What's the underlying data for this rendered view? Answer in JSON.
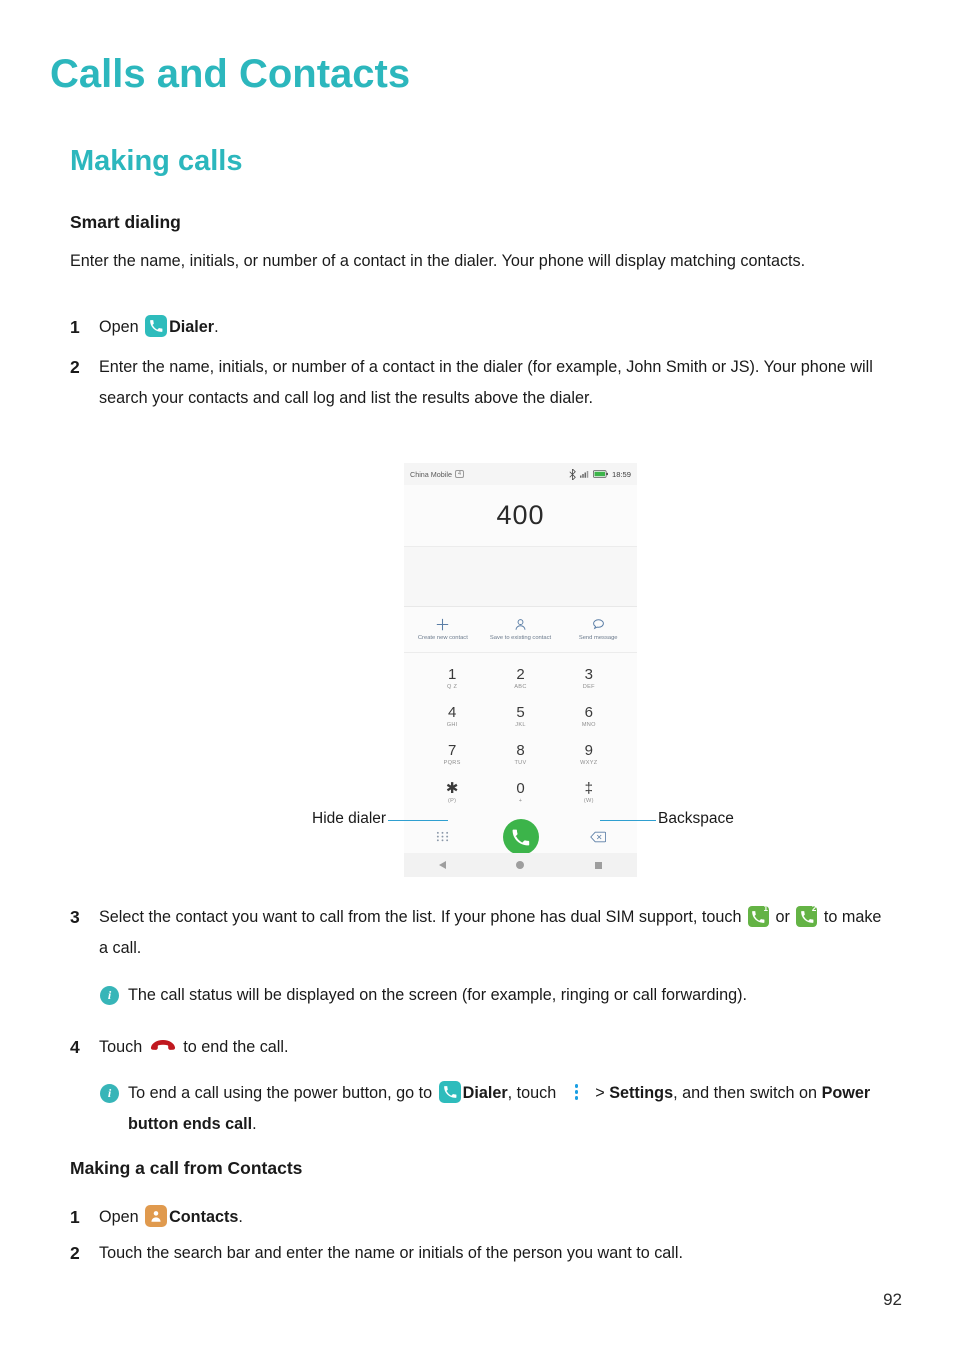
{
  "page_title": "Calls and Contacts",
  "section_title": "Making calls",
  "smart_dialing": {
    "title": "Smart dialing",
    "intro": "Enter the name, initials, or number of a contact in the dialer. Your phone will display matching contacts.",
    "step1": {
      "num": "1",
      "before_icon": "Open ",
      "icon": "dialer-app-icon",
      "app_label": "Dialer",
      "after": "."
    },
    "step2": {
      "num": "2",
      "text": "Enter the name, initials, or number of a contact in the dialer (for example, John Smith or JS). Your phone will search your contacts and call log and list the results above the dialer."
    },
    "step3": {
      "num": "3",
      "text_before": "Select the contact you want to call from the list. If your phone has dual SIM support, touch ",
      "sim1_icon": "sim1-call-icon",
      "sim1_badge": "1",
      "between": " or ",
      "sim2_icon": "sim2-call-icon",
      "sim2_badge": "2",
      "text_after": " to make a call."
    },
    "note1": "The call status will be displayed on the screen (for example, ringing or call forwarding).",
    "step4": {
      "num": "4",
      "text_before": "Touch ",
      "icon": "end-call-icon",
      "text_after": " to end the call."
    },
    "note2": {
      "part1": "To end a call using the power button, go to ",
      "dialer_label": "Dialer",
      "part2": ", touch ",
      "menu_icon": "overflow-menu-icon",
      "part3": " > ",
      "settings_label": "Settings",
      "part4": ", and then switch on ",
      "toggle_label": "Power button ends call",
      "part5": "."
    }
  },
  "contacts_section": {
    "title": "Making a call from Contacts",
    "step1": {
      "num": "1",
      "before_icon": "Open ",
      "icon": "contacts-app-icon",
      "app_label": "Contacts",
      "after": "."
    },
    "step2": {
      "num": "2",
      "text": "Touch the search bar and enter the name or initials of the person you want to call."
    }
  },
  "phone_screenshot": {
    "status_bar": {
      "carrier": "China Mobile",
      "sim_badge": "4",
      "bluetooth_icon": "bluetooth-icon",
      "signal_icon": "signal-bars-icon",
      "battery_icon": "battery-icon",
      "time": "18:59"
    },
    "dialed_number": "400",
    "actions": [
      {
        "icon": "plus-icon",
        "label": "Create new contact"
      },
      {
        "icon": "person-icon",
        "label": "Save to existing contact"
      },
      {
        "icon": "message-bubble-icon",
        "label": "Send message"
      }
    ],
    "keypad": [
      [
        {
          "digit": "1",
          "sub": "Q Z"
        },
        {
          "digit": "2",
          "sub": "ABC"
        },
        {
          "digit": "3",
          "sub": "DEF"
        }
      ],
      [
        {
          "digit": "4",
          "sub": "GHI"
        },
        {
          "digit": "5",
          "sub": "JKL"
        },
        {
          "digit": "6",
          "sub": "MNO"
        }
      ],
      [
        {
          "digit": "7",
          "sub": "PQRS"
        },
        {
          "digit": "8",
          "sub": "TUV"
        },
        {
          "digit": "9",
          "sub": "WXYZ"
        }
      ],
      [
        {
          "digit": "✱",
          "sub": "(P)"
        },
        {
          "digit": "0",
          "sub": "+"
        },
        {
          "digit": "‡",
          "sub": "(W)"
        }
      ]
    ],
    "bottom_row": {
      "hide_dialer_icon": "keypad-dots-icon",
      "call_button_icon": "call-handset-icon",
      "backspace_icon": "backspace-icon"
    },
    "navbar": {
      "back_icon": "nav-back-icon",
      "home_icon": "nav-home-icon",
      "recents_icon": "nav-recents-icon"
    }
  },
  "callouts": {
    "hide_dialer": "Hide dialer",
    "backspace": "Backspace"
  },
  "page_number": "92",
  "colors": {
    "accent_teal": "#2cb7bd",
    "call_green": "#3cb44a",
    "sim_green": "#64b345",
    "contacts_orange": "#e09a4e",
    "end_call_red": "#c0181f",
    "callout_blue": "#2f9fd0"
  }
}
